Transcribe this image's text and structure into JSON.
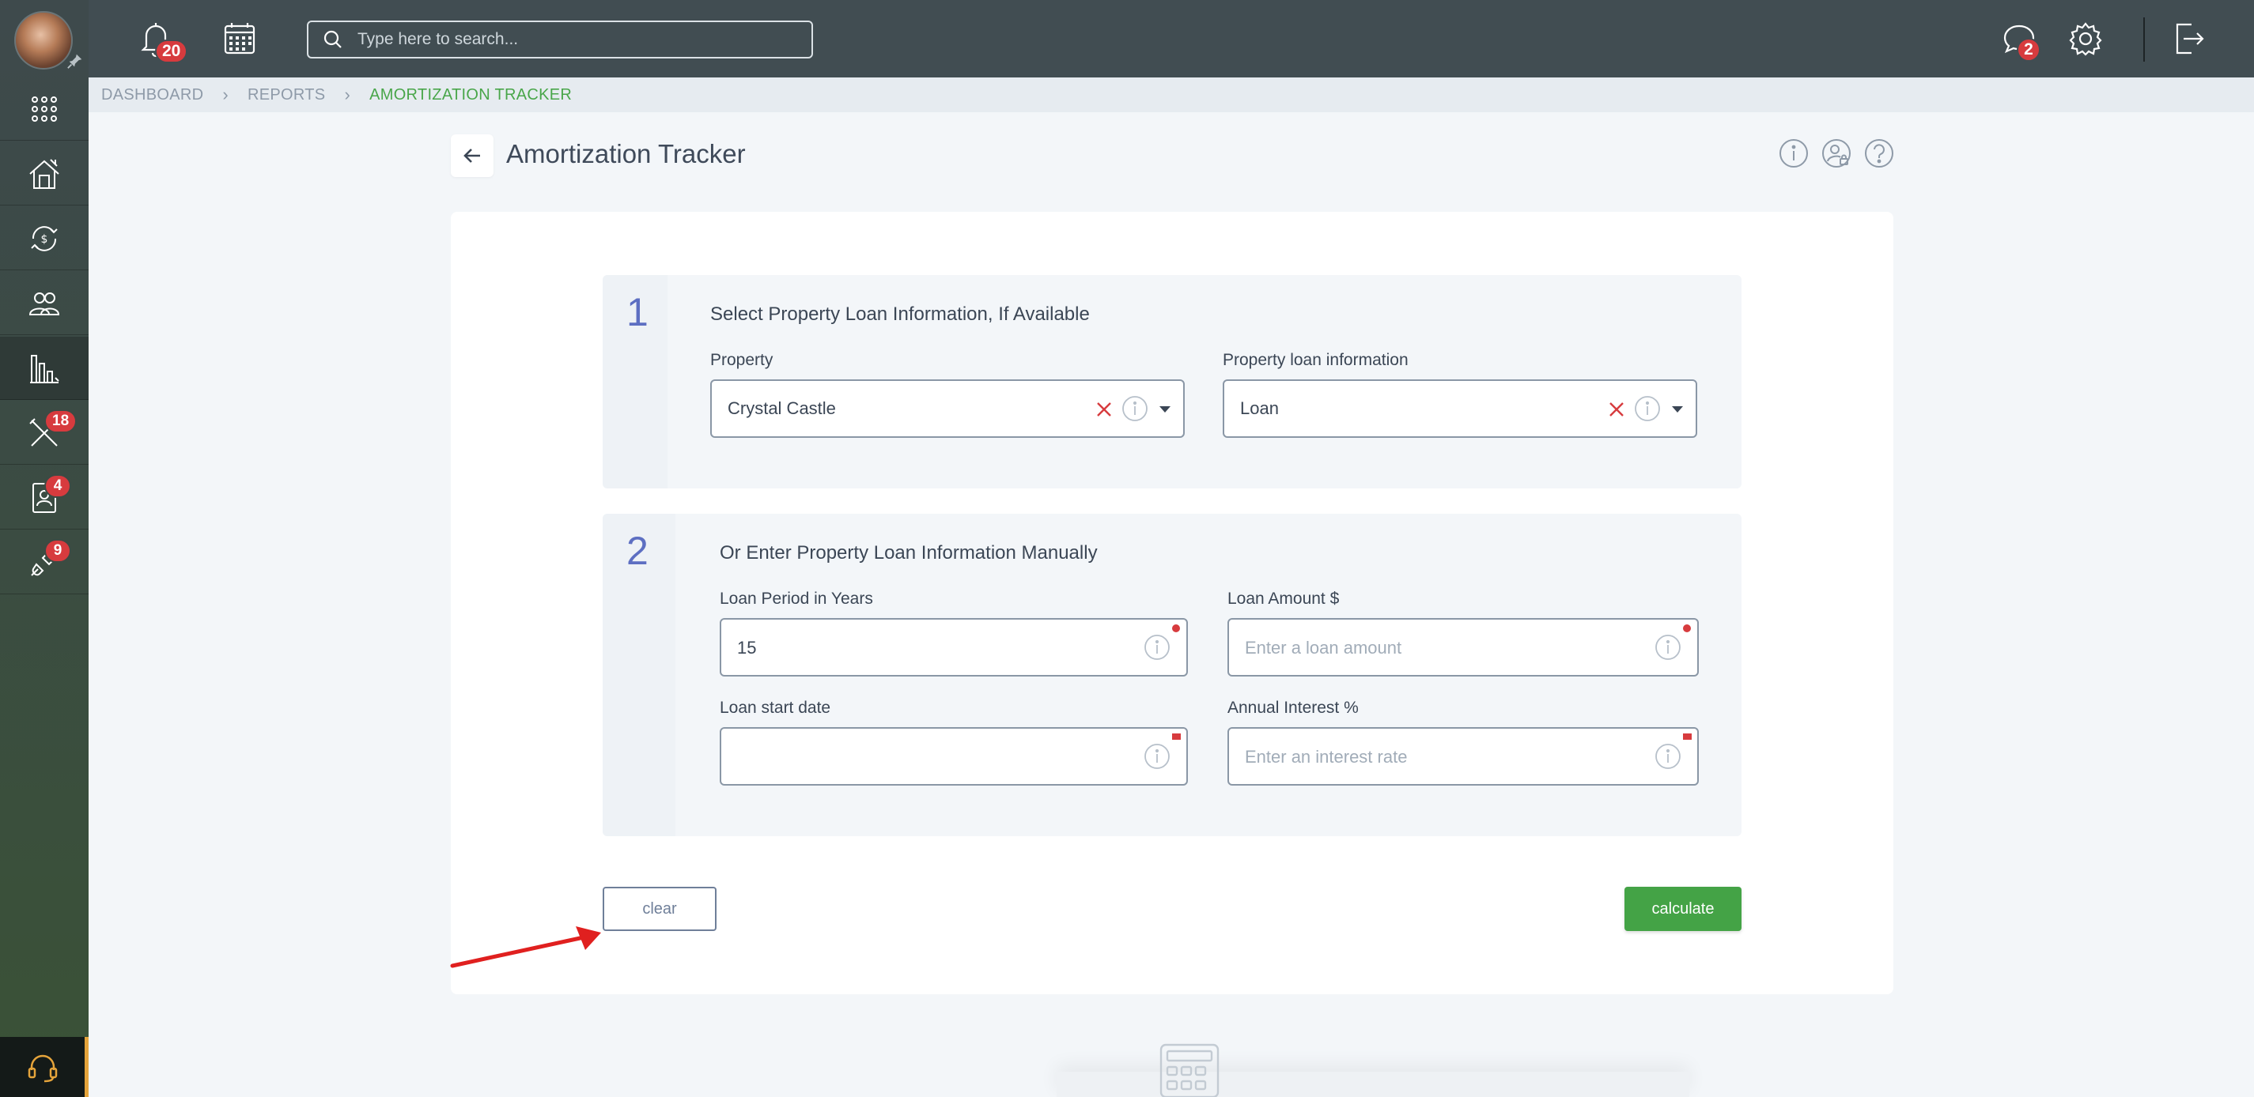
{
  "topbar": {
    "notifications_count": "20",
    "search_placeholder": "Type here to search...",
    "messages_count": "2"
  },
  "sidebar": {
    "items": [
      {
        "icon": "apps-grid-icon"
      },
      {
        "icon": "property-house-icon"
      },
      {
        "icon": "money-cycle-icon"
      },
      {
        "icon": "people-icon"
      },
      {
        "icon": "reports-chart-icon"
      },
      {
        "icon": "tools-icon",
        "badge": "18"
      },
      {
        "icon": "tenant-document-icon",
        "badge": "4"
      },
      {
        "icon": "integrations-plug-icon",
        "badge": "9"
      }
    ],
    "support_icon": "headset-icon"
  },
  "breadcrumb": {
    "items": [
      "DASHBOARD",
      "REPORTS",
      "AMORTIZATION TRACKER"
    ]
  },
  "page": {
    "title": "Amortization Tracker"
  },
  "section1": {
    "number": "1",
    "title": "Select Property Loan Information, If Available",
    "property_label": "Property",
    "property_value": "Crystal Castle",
    "loan_info_label": "Property loan information",
    "loan_info_value": "Loan"
  },
  "section2": {
    "number": "2",
    "title": "Or Enter Property Loan Information Manually",
    "period_label": "Loan Period in Years",
    "period_value": "15",
    "amount_label": "Loan Amount $",
    "amount_placeholder": "Enter a loan amount",
    "start_label": "Loan start date",
    "start_value": "",
    "interest_label": "Annual Interest %",
    "interest_placeholder": "Enter an interest rate"
  },
  "actions": {
    "clear_label": "clear",
    "calculate_label": "calculate"
  },
  "colors": {
    "accent_green": "#44a346",
    "badge_red": "#d73b3e",
    "section_number": "#5d6fc2",
    "annotation_arrow": "#e0201f"
  }
}
